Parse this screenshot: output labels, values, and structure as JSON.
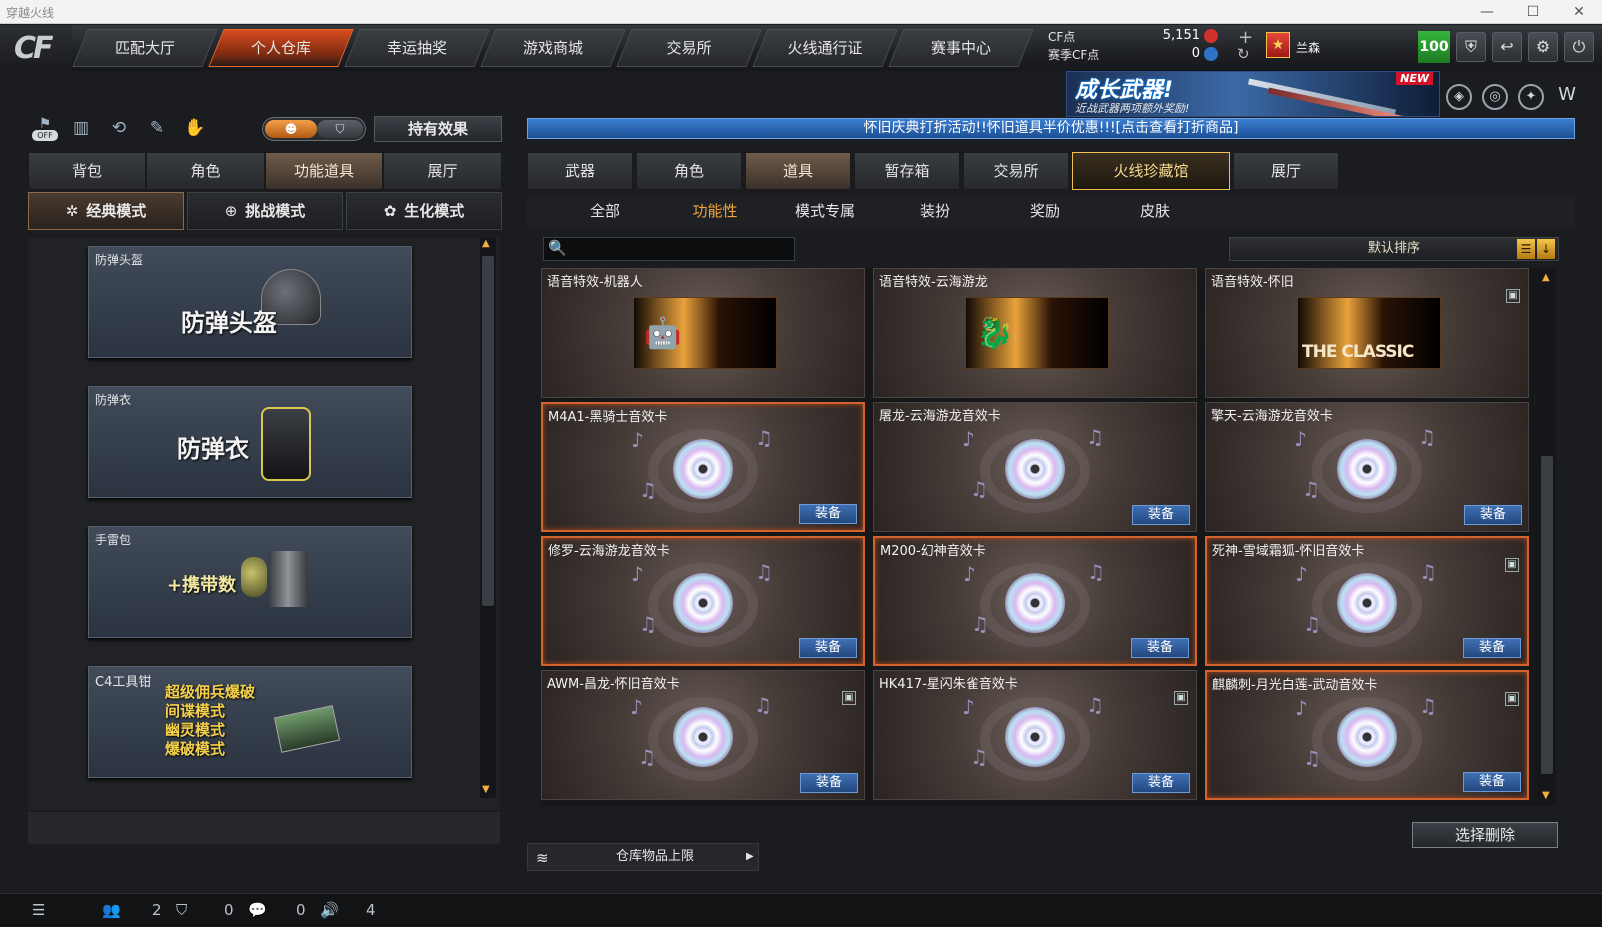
{
  "window": {
    "title": "穿越火线",
    "controls": [
      "—",
      "☐",
      "✕"
    ]
  },
  "topnav": {
    "tabs": [
      "匹配大厅",
      "个人仓库",
      "幸运抽奖",
      "游戏商城",
      "交易所",
      "火线通行证",
      "赛事中心"
    ],
    "active_index": 1,
    "cf_label": "CF点",
    "cf_value": "5,151",
    "event_cf_label": "赛季CF点",
    "event_cf_value": "0",
    "player_name": "兰森",
    "level_badge": "100"
  },
  "banner": {
    "title": "成长武器!",
    "subtitle": "近战武器两项额外奖励!",
    "badge": "NEW"
  },
  "left": {
    "effect_button": "持有效果",
    "toggle_off_label": "OFF",
    "tabs": [
      "背包",
      "角色",
      "功能道具",
      "展厅"
    ],
    "tab_selected": 2,
    "modes": [
      "经典模式",
      "挑战模式",
      "生化模式"
    ],
    "mode_selected": 0,
    "items": [
      {
        "label": "防弹头盔",
        "title": "防弹头盔"
      },
      {
        "label": "防弹衣",
        "title": "防弹衣"
      },
      {
        "label": "手雷包",
        "title": "+携带数"
      },
      {
        "label": "C4工具钳",
        "lines": [
          "超级佣兵爆破",
          "间谍模式",
          "幽灵模式",
          "爆破模式"
        ]
      }
    ]
  },
  "right": {
    "marquee": "怀旧庆典打折活动!!怀旧道具半价优惠!!![点击查看打折商品]",
    "tabs": [
      "武器",
      "角色",
      "道具",
      "暂存箱",
      "交易所",
      "火线珍藏馆",
      "展厅"
    ],
    "tab_selected": 2,
    "subtabs": [
      "全部",
      "功能性",
      "模式专属",
      "装扮",
      "奖励",
      "皮肤"
    ],
    "subtab_selected": 1,
    "search_placeholder": "",
    "sort_label": "默认排序",
    "equip_label": "装备",
    "cards": [
      {
        "name": "语音特效-机器人",
        "type": "sfx",
        "glyph": "🤖",
        "locked": false,
        "hl": false
      },
      {
        "name": "语音特效-云海游龙",
        "type": "sfx",
        "glyph": "🐉",
        "locked": false,
        "hl": false
      },
      {
        "name": "语音特效-怀旧",
        "type": "sfx",
        "text": "THE CLASSIC",
        "locked": true,
        "hl": false
      },
      {
        "name": "M4A1-黑骑士音效卡",
        "type": "disc",
        "locked": false,
        "hl": true
      },
      {
        "name": "屠龙-云海游龙音效卡",
        "type": "disc",
        "locked": false,
        "hl": false
      },
      {
        "name": "擎天-云海游龙音效卡",
        "type": "disc",
        "locked": false,
        "hl": false
      },
      {
        "name": "修罗-云海游龙音效卡",
        "type": "disc",
        "locked": false,
        "hl": true
      },
      {
        "name": "M200-幻神音效卡",
        "type": "disc",
        "locked": false,
        "hl": true
      },
      {
        "name": "死神-雪域霜狐-怀旧音效卡",
        "type": "disc",
        "locked": true,
        "hl": true
      },
      {
        "name": "AWM-昌龙-怀旧音效卡",
        "type": "disc",
        "locked": true,
        "hl": false
      },
      {
        "name": "HK417-星闪朱雀音效卡",
        "type": "disc",
        "locked": true,
        "hl": false
      },
      {
        "name": "麒麟刺-月光白莲-武动音效卡",
        "type": "disc",
        "locked": true,
        "hl": true
      }
    ],
    "delete_button": "选择删除",
    "capacity_label": "仓库物品上限"
  },
  "status": {
    "friends": "2",
    "guild": "0",
    "chat": "0",
    "voice": "4"
  }
}
